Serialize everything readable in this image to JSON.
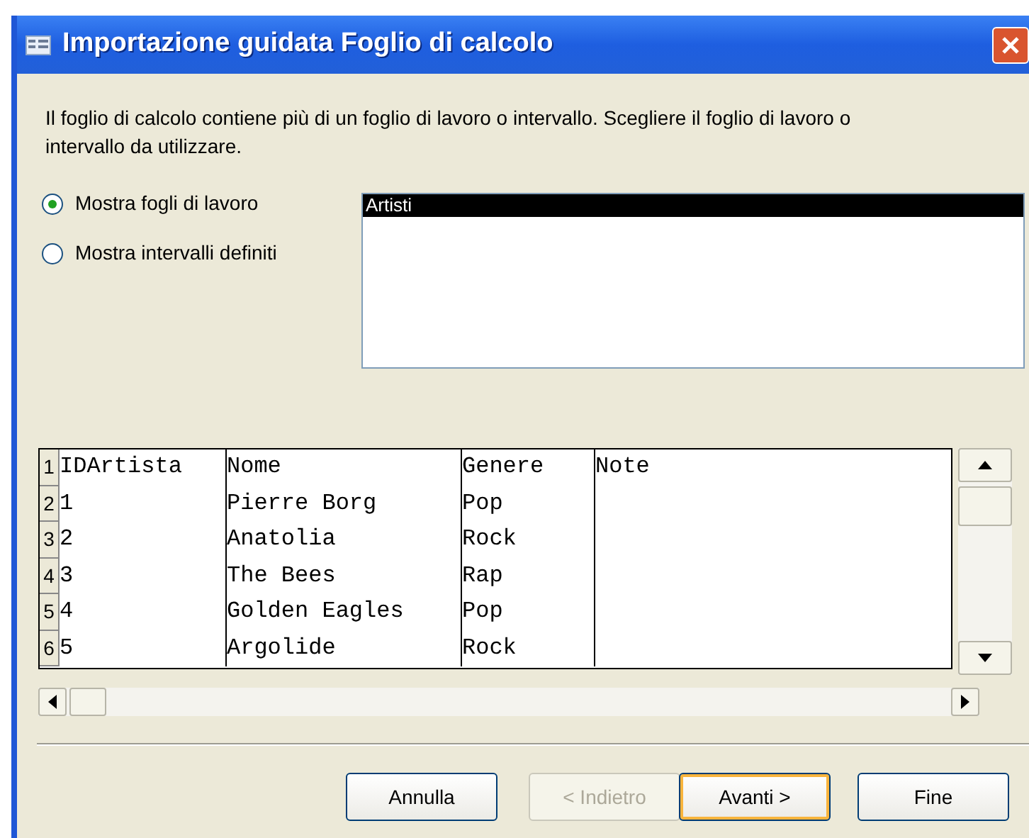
{
  "window": {
    "title": "Importazione guidata Foglio di calcolo"
  },
  "intro": "Il foglio di calcolo contiene più di un foglio di lavoro o intervallo. Scegliere il foglio di lavoro o intervallo da utilizzare.",
  "options": [
    {
      "label": "Mostra fogli di lavoro",
      "selected": true
    },
    {
      "label": "Mostra intervalli definiti",
      "selected": false
    }
  ],
  "sheets": [
    {
      "label": "Artisti",
      "selected": true
    }
  ],
  "preview": {
    "rows": [
      {
        "number": "1",
        "cells": [
          "IDArtista",
          "Nome",
          "Genere",
          "Note"
        ]
      },
      {
        "number": "2",
        "cells": [
          "1",
          "Pierre Borg",
          "Pop",
          ""
        ]
      },
      {
        "number": "3",
        "cells": [
          "2",
          "Anatolia",
          "Rock",
          ""
        ]
      },
      {
        "number": "4",
        "cells": [
          "3",
          "The Bees",
          "Rap",
          ""
        ]
      },
      {
        "number": "5",
        "cells": [
          "4",
          "Golden Eagles",
          "Pop",
          ""
        ]
      },
      {
        "number": "6",
        "cells": [
          "5",
          "Argolide",
          "Rock",
          ""
        ]
      }
    ]
  },
  "buttons": [
    {
      "label": "Annulla",
      "disabled": false,
      "default": false
    },
    {
      "label": "< Indietro",
      "disabled": true,
      "default": false
    },
    {
      "label": "Avanti >",
      "disabled": false,
      "default": true
    },
    {
      "label": "Fine",
      "disabled": false,
      "default": false
    }
  ]
}
